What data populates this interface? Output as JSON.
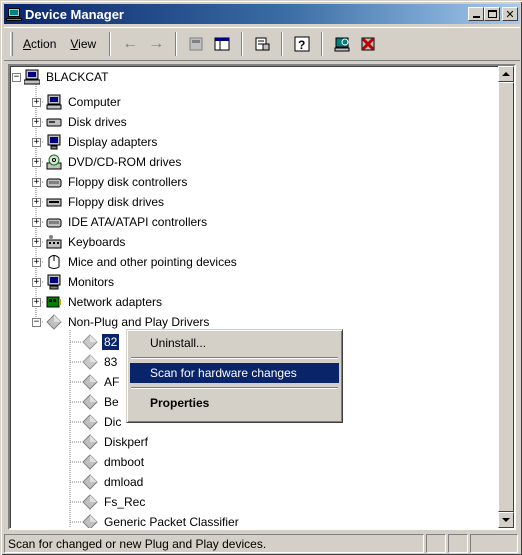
{
  "window": {
    "title": "Device Manager"
  },
  "toolbar": {
    "action_label": "Action",
    "view_label": "View"
  },
  "tree": {
    "root": "BLACKCAT",
    "categories": [
      {
        "label": "Computer",
        "icon": "computer-icon"
      },
      {
        "label": "Disk drives",
        "icon": "disk-drive-icon"
      },
      {
        "label": "Display adapters",
        "icon": "display-adapter-icon"
      },
      {
        "label": "DVD/CD-ROM drives",
        "icon": "cdrom-icon"
      },
      {
        "label": "Floppy disk controllers",
        "icon": "controller-icon"
      },
      {
        "label": "Floppy disk drives",
        "icon": "floppy-drive-icon"
      },
      {
        "label": "IDE ATA/ATAPI controllers",
        "icon": "controller-icon"
      },
      {
        "label": "Keyboards",
        "icon": "keyboard-icon"
      },
      {
        "label": "Mice and other pointing devices",
        "icon": "mouse-icon"
      },
      {
        "label": "Monitors",
        "icon": "monitor-icon"
      },
      {
        "label": "Network adapters",
        "icon": "network-adapter-icon"
      },
      {
        "label": "Non-Plug and Play Drivers",
        "icon": "driver-icon"
      }
    ],
    "drivers": [
      "82",
      "83",
      "AF",
      "Be",
      "Dic",
      "Diskperf",
      "dmboot",
      "dmload",
      "Fs_Rec",
      "Generic Packet Classifier"
    ]
  },
  "context_menu": {
    "uninstall": "Uninstall...",
    "scan": "Scan for hardware changes",
    "properties": "Properties"
  },
  "status": {
    "text": "Scan for changed or new Plug and Play devices."
  }
}
